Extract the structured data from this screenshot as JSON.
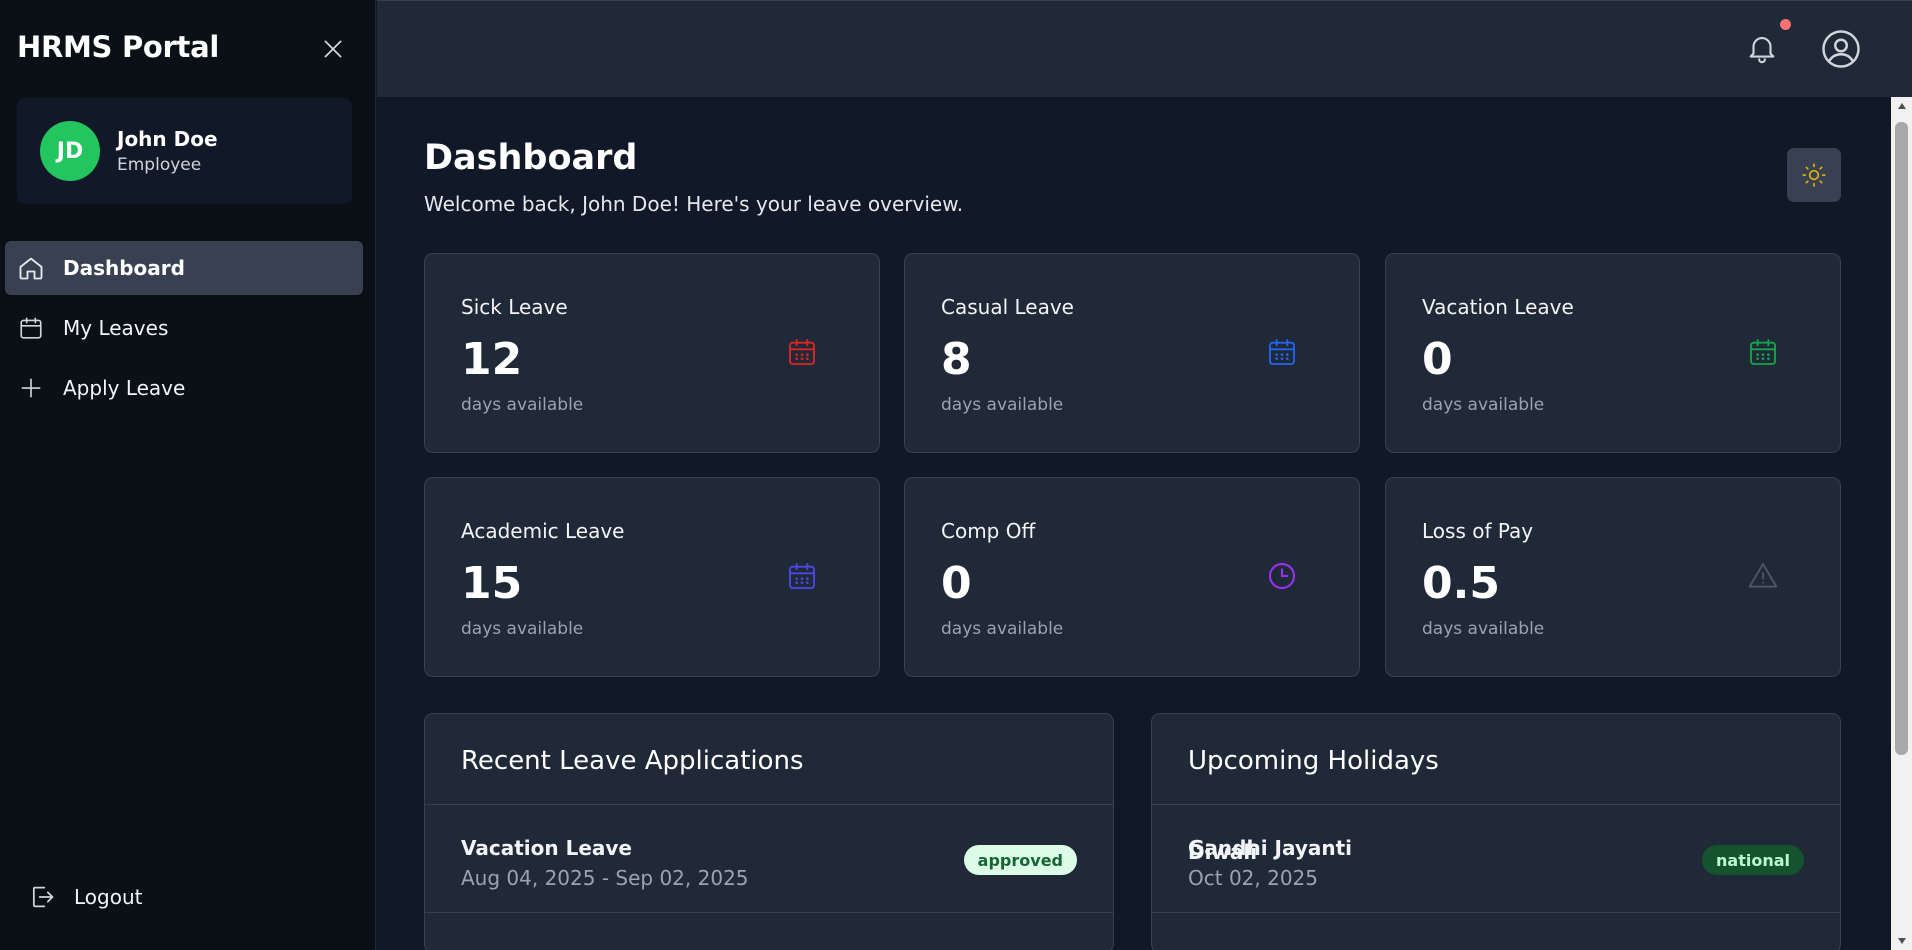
{
  "sidebar": {
    "brand": "HRMS Portal",
    "user": {
      "initials": "JD",
      "name": "John Doe",
      "role": "Employee"
    },
    "nav": [
      {
        "label": "Dashboard",
        "icon": "home-icon",
        "active": true
      },
      {
        "label": "My Leaves",
        "icon": "calendar-icon",
        "active": false
      },
      {
        "label": "Apply Leave",
        "icon": "plus-icon",
        "active": false
      }
    ],
    "logout_label": "Logout"
  },
  "header": {
    "title": "Dashboard",
    "subtitle": "Welcome back, John Doe! Here's your leave overview."
  },
  "cards": [
    {
      "title": "Sick Leave",
      "value": "12",
      "unit": "days available",
      "icon": "calendar-icon",
      "color": "#dc2626"
    },
    {
      "title": "Casual Leave",
      "value": "8",
      "unit": "days available",
      "icon": "calendar-icon",
      "color": "#2563eb"
    },
    {
      "title": "Vacation Leave",
      "value": "0",
      "unit": "days available",
      "icon": "calendar-icon",
      "color": "#16a34a"
    },
    {
      "title": "Academic Leave",
      "value": "15",
      "unit": "days available",
      "icon": "calendar-icon",
      "color": "#4f46e5"
    },
    {
      "title": "Comp Off",
      "value": "0",
      "unit": "days available",
      "icon": "clock-icon",
      "color": "#9333ea"
    },
    {
      "title": "Loss of Pay",
      "value": "0.5",
      "unit": "days available",
      "icon": "warning-icon",
      "color": "#4b5563"
    }
  ],
  "recent": {
    "title": "Recent Leave Applications",
    "items": [
      {
        "name": "Vacation Leave",
        "dates": "Aug 04, 2025 - Sep 02, 2025",
        "status": "approved"
      }
    ]
  },
  "holidays": {
    "title": "Upcoming Holidays",
    "items": [
      {
        "name": "Gandhi Jayanti",
        "date": "Oct 02, 2025",
        "type": "national"
      }
    ],
    "next_partial": "Diwali"
  },
  "colors": {
    "accent_green": "#22c55e",
    "notification_dot": "#f87171",
    "sun": "#eab308"
  }
}
